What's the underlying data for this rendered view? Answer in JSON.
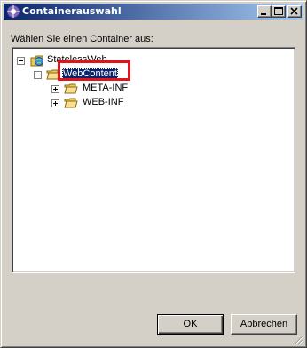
{
  "window": {
    "title": "Containerauswahl",
    "controls": [
      "minimize-icon",
      "maximize-icon",
      "close-icon"
    ]
  },
  "dialog": {
    "prompt": "Wählen Sie einen Container aus:"
  },
  "tree": {
    "nodes": [
      {
        "label": "StatelessWeb",
        "icon": "web-project-icon",
        "expanded": true,
        "level": 0
      },
      {
        "label": "WebContent",
        "icon": "folder-open-icon",
        "expanded": true,
        "level": 1,
        "selected": true
      },
      {
        "label": "META-INF",
        "icon": "folder-icon",
        "expanded": false,
        "level": 2
      },
      {
        "label": "WEB-INF",
        "icon": "folder-icon",
        "expanded": false,
        "level": 2
      }
    ]
  },
  "buttons": {
    "ok": "OK",
    "cancel": "Abbrechen"
  },
  "colors": {
    "selection": "#0a246a",
    "highlight_box": "#e0141c",
    "title_gradient_start": "#0a246a",
    "title_gradient_end": "#a6caf0"
  }
}
